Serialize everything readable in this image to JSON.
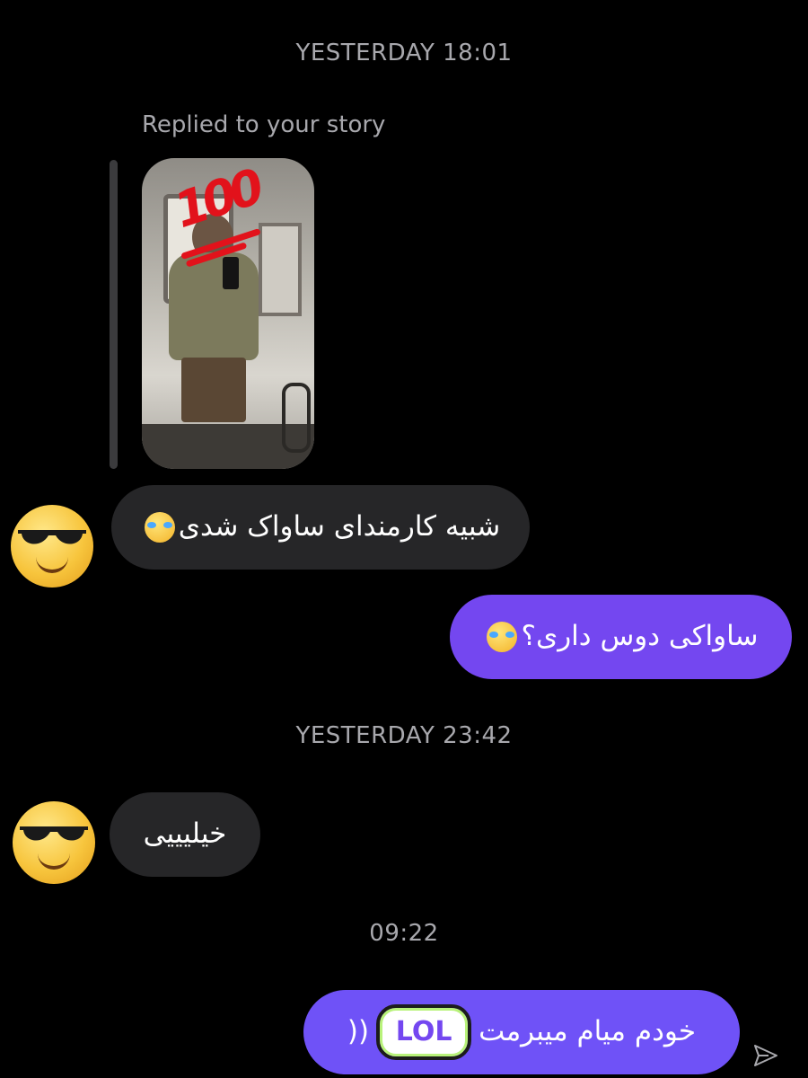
{
  "timestamps": [
    "YESTERDAY 18:01",
    "YESTERDAY 23:42",
    "09:22"
  ],
  "reply": {
    "label": "Replied to your story",
    "story_sticker": "100"
  },
  "messages": [
    {
      "side": "in",
      "text": "شبیه کارمندای ساواک شدی",
      "emoji": "face-with-tears-of-joy"
    },
    {
      "side": "out",
      "text": "ساواکی دوس داری؟",
      "emoji": "face-with-tears-of-joy"
    },
    {
      "side": "in",
      "text": "خیلیییی"
    },
    {
      "side": "out",
      "text": "خودم میام میبرمت",
      "suffix": "((",
      "sticker": "LOL"
    }
  ],
  "colors": {
    "background": "#000000",
    "incoming_bubble": "#262628",
    "outgoing_bubble": "#7447f0",
    "timestamp": "#a8a8ad"
  },
  "icons": {
    "avatar": "sunglasses-face-icon",
    "send": "send-arrow-icon"
  }
}
